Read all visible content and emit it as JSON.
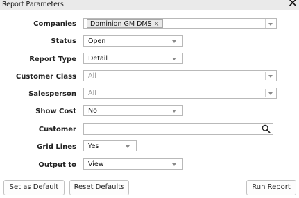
{
  "window": {
    "title": "Report Parameters",
    "close_glyph": "✕",
    "close_icon": "close-icon"
  },
  "form": {
    "companies": {
      "label": "Companies",
      "tag": "Dominion GM DMS",
      "tag_remove": "×"
    },
    "status": {
      "label": "Status",
      "value": "Open"
    },
    "report_type": {
      "label": "Report Type",
      "value": "Detail"
    },
    "customer_class": {
      "label": "Customer Class",
      "value": "All"
    },
    "salesperson": {
      "label": "Salesperson",
      "value": "All"
    },
    "show_cost": {
      "label": "Show Cost",
      "value": "No"
    },
    "customer": {
      "label": "Customer",
      "value": "",
      "icon": "search-icon"
    },
    "grid_lines": {
      "label": "Grid Lines",
      "value": "Yes"
    },
    "output_to": {
      "label": "Output to",
      "value": "View"
    }
  },
  "buttons": {
    "set_default": "Set as Default",
    "reset_defaults": "Reset Defaults",
    "run_report": "Run Report"
  }
}
